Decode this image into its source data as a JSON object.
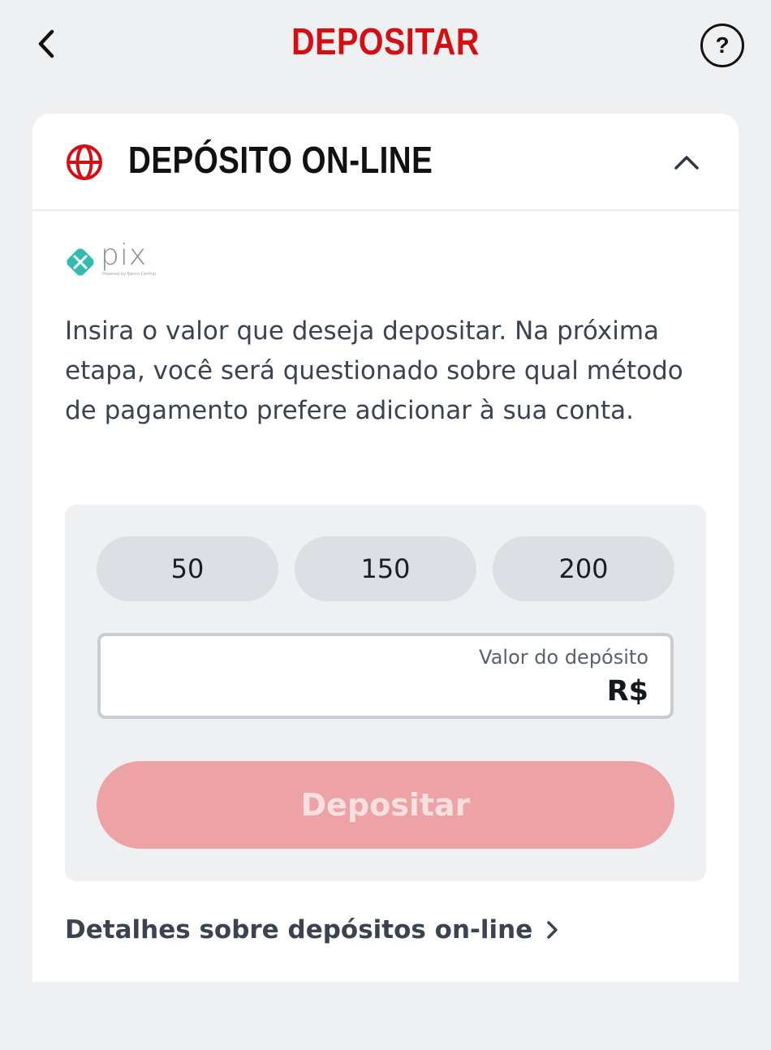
{
  "topbar": {
    "title": "DEPOSITAR",
    "back_icon": "chevron-left-icon",
    "help_label": "?",
    "help_icon": "help-circle-icon",
    "title_color": "#d40f14"
  },
  "section": {
    "title": "DEPÓSITO ON-LINE",
    "icon": "globe-icon",
    "toggle_icon": "chevron-up-icon",
    "icon_color": "#d40f14"
  },
  "payment_method": {
    "logo_text": "pix",
    "logo_subtext": "Powered by Banco Central",
    "logo_color": "#32bcad"
  },
  "intro_text": "Insira o valor que deseja depositar. Na próxima etapa, você será questionado sobre qual método de pagamento prefere adicionar à sua conta.",
  "quick_amounts": [
    "50",
    "150",
    "200"
  ],
  "amount_field": {
    "label": "Valor do depósito",
    "currency": "R$",
    "value": ""
  },
  "deposit_button": {
    "label": "Depositar",
    "state": "disabled",
    "color": "#eda3a6"
  },
  "details_link": {
    "label": "Detalhes sobre depósitos on-line",
    "icon": "chevron-right-icon"
  }
}
